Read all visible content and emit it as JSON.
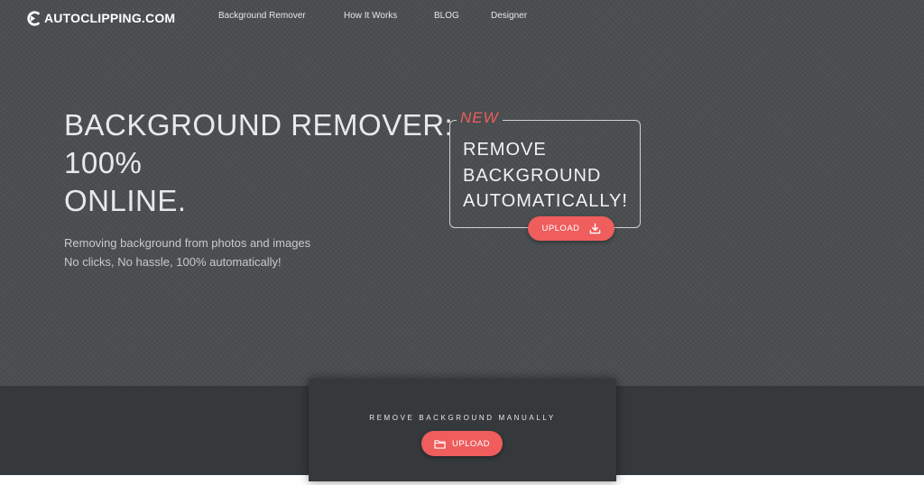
{
  "navbar": {
    "logo_text": "AUTOCLIPPING.COM",
    "links": [
      "Background Remover",
      "How It Works",
      "BLOG",
      "Designer"
    ]
  },
  "hero": {
    "headline": [
      "BACKGROUND REMOVER:",
      "100%",
      "ONLINE."
    ],
    "subtitle": [
      "Removing background from photos and images",
      "No clicks, No hassle, 100% automatically!"
    ]
  },
  "promo": {
    "badge": "NEW",
    "lines": [
      "REMOVE",
      "BACKGROUND",
      "AUTOMATICALLY!"
    ],
    "button_label": "UPLOAD",
    "button_icon": "download-icon"
  },
  "manual": {
    "title": "REMOVE BACKGROUND MANUALLY",
    "button_label": "UPLOAD",
    "button_icon": "folder-icon"
  },
  "colors": {
    "hero_background": "#4a4e50",
    "band_background": "#35393b",
    "accent": "#ef5d5c",
    "text": "#ffffff"
  }
}
